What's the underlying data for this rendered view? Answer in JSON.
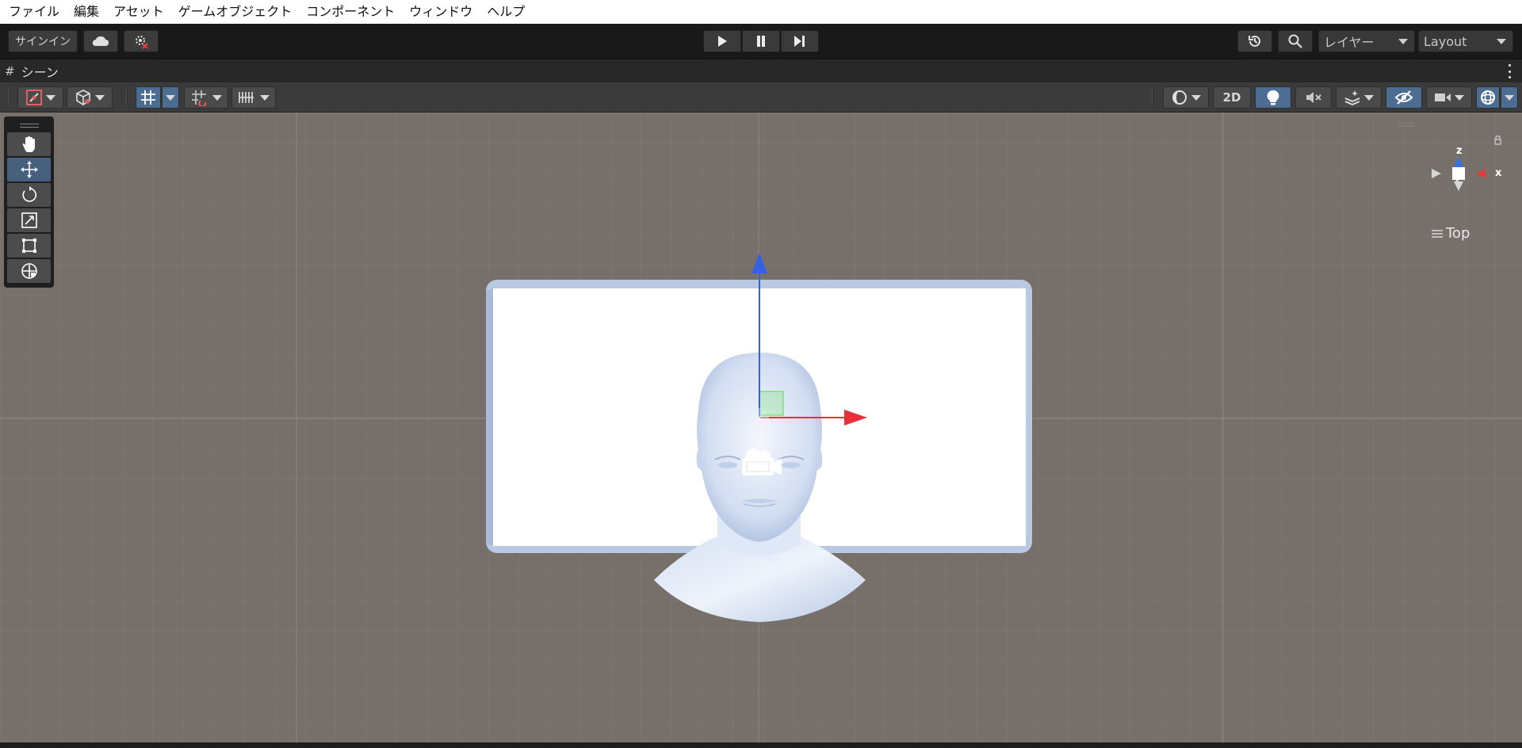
{
  "menubar": {
    "items": [
      "ファイル",
      "編集",
      "アセット",
      "ゲームオブジェクト",
      "コンポーネント",
      "ウィンドウ",
      "ヘルプ"
    ]
  },
  "toolbar": {
    "signin_label": "サインイン",
    "cloud_icon": "cloud-icon",
    "collab_icon": "collab-icon",
    "play_icon": "play-icon",
    "pause_icon": "pause-icon",
    "step_icon": "step-icon",
    "history_icon": "history-icon",
    "search_icon": "search-icon",
    "layers_label": "レイヤー",
    "layout_label": "Layout"
  },
  "scene_tab": {
    "label": "シーン",
    "icon": "hash-icon"
  },
  "scene_toolbar": {
    "toggle_2d_label": "2D",
    "accent_color": "#4c6c92"
  },
  "tools": {
    "items": [
      "hand",
      "move",
      "rotate",
      "scale",
      "rect",
      "transform"
    ],
    "active": "move"
  },
  "gizmo": {
    "view_label": "Top",
    "z_label": "z",
    "x_label": "x",
    "x_color": "#e03a3a",
    "z_color": "#3a6fe0"
  },
  "viewport": {
    "background": "#77706a",
    "handle_x_color": "#e8303a",
    "handle_z_color": "#3560e6",
    "handle_y_color": "#7ee07e"
  }
}
